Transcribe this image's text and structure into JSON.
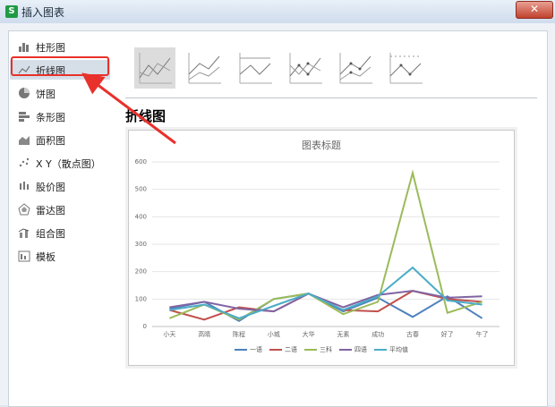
{
  "window": {
    "title": "插入图表",
    "app_icon": "S",
    "close_label": "✕"
  },
  "sidebar": {
    "items": [
      {
        "label": "柱形图",
        "icon": "column-chart-icon"
      },
      {
        "label": "折线图",
        "icon": "line-chart-icon",
        "selected": true
      },
      {
        "label": "饼图",
        "icon": "pie-chart-icon"
      },
      {
        "label": "条形图",
        "icon": "bar-chart-icon"
      },
      {
        "label": "面积图",
        "icon": "area-chart-icon"
      },
      {
        "label": "X Y（散点图）",
        "icon": "scatter-chart-icon"
      },
      {
        "label": "股价图",
        "icon": "stock-chart-icon"
      },
      {
        "label": "雷达图",
        "icon": "radar-chart-icon"
      },
      {
        "label": "组合图",
        "icon": "combo-chart-icon"
      },
      {
        "label": "模板",
        "icon": "template-icon"
      }
    ]
  },
  "main": {
    "heading": "折线图",
    "subtypes": [
      "line",
      "stacked-line",
      "percent-stacked-line",
      "line-markers",
      "stacked-line-markers",
      "percent-stacked-line-markers"
    ]
  },
  "colors": {
    "accent_red": "#e8312b",
    "series": [
      "#4e81bd",
      "#c0504d",
      "#9bbb59",
      "#8064a2",
      "#4bacc6"
    ]
  },
  "chart_data": {
    "type": "line",
    "title": "图表标题",
    "categories": [
      "小天",
      "高晴",
      "陈程",
      "小城",
      "大华",
      "无素",
      "成功",
      "古春",
      "好了",
      "午了"
    ],
    "ylim": [
      0,
      600
    ],
    "yticks": [
      0,
      100,
      200,
      300,
      400,
      500,
      600
    ],
    "series": [
      {
        "name": "一语",
        "values": [
          65,
          90,
          20,
          100,
          120,
          55,
          105,
          35,
          110,
          30
        ]
      },
      {
        "name": "二语",
        "values": [
          60,
          25,
          70,
          55,
          120,
          60,
          55,
          130,
          100,
          90
        ]
      },
      {
        "name": "三科",
        "values": [
          30,
          80,
          25,
          100,
          120,
          45,
          90,
          560,
          50,
          90
        ]
      },
      {
        "name": "四语",
        "values": [
          70,
          90,
          65,
          55,
          120,
          70,
          115,
          130,
          105,
          110
        ]
      },
      {
        "name": "平均值",
        "values": [
          60,
          80,
          30,
          75,
          120,
          60,
          110,
          215,
          95,
          80
        ]
      }
    ],
    "legend_position": "bottom",
    "grid": true
  }
}
